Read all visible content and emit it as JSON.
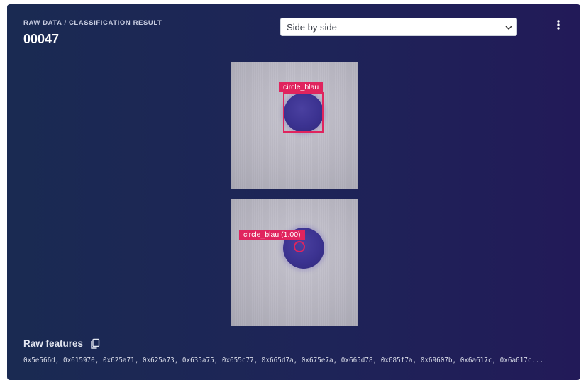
{
  "header": {
    "breadcrumb": "RAW DATA / CLASSIFICATION RESULT",
    "sample_id": "00047"
  },
  "view_select": {
    "selected": "Side by side"
  },
  "images": {
    "raw": {
      "label": "circle_blau"
    },
    "classified": {
      "label": "circle_blau (1.00)"
    }
  },
  "raw_features": {
    "label": "Raw features",
    "values": "0x5e566d, 0x615970, 0x625a71, 0x625a73, 0x635a75, 0x655c77, 0x665d7a, 0x675e7a, 0x665d78, 0x685f7a, 0x69607b, 0x6a617c, 0x6a617c..."
  },
  "colors": {
    "panel": "#1e2458",
    "accent": "#e0245e",
    "disc": "#3b3290"
  },
  "icons": [
    "chevron-down-icon",
    "more-vertical-icon",
    "copy-icon"
  ]
}
